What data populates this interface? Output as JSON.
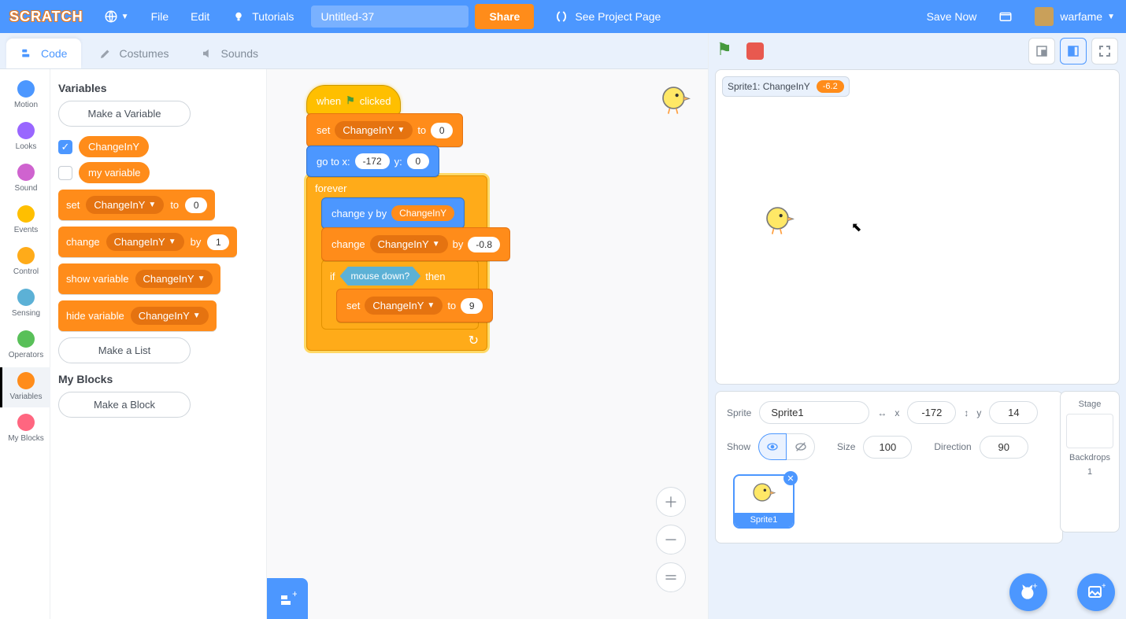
{
  "menubar": {
    "logo": "SCRATCH",
    "file": "File",
    "edit": "Edit",
    "tutorials": "Tutorials",
    "project_title": "Untitled-37",
    "share": "Share",
    "see_project_page": "See Project Page",
    "save_now": "Save Now",
    "username": "warfame"
  },
  "tabs": {
    "code": "Code",
    "costumes": "Costumes",
    "sounds": "Sounds"
  },
  "categories": [
    {
      "name": "Motion",
      "color": "#4C97FF"
    },
    {
      "name": "Looks",
      "color": "#9966FF"
    },
    {
      "name": "Sound",
      "color": "#CF63CF"
    },
    {
      "name": "Events",
      "color": "#FFBF00"
    },
    {
      "name": "Control",
      "color": "#FFAB19"
    },
    {
      "name": "Sensing",
      "color": "#5CB1D6"
    },
    {
      "name": "Operators",
      "color": "#59C059"
    },
    {
      "name": "Variables",
      "color": "#FF8C1A"
    },
    {
      "name": "My Blocks",
      "color": "#FF6680"
    }
  ],
  "palette": {
    "variables_header": "Variables",
    "make_variable": "Make a Variable",
    "var1": "ChangeInY",
    "var2": "my variable",
    "set_label": "set",
    "to_label": "to",
    "set_value": "0",
    "change_label": "change",
    "by_label": "by",
    "change_value": "1",
    "show_label": "show variable",
    "hide_label": "hide variable",
    "make_list": "Make a List",
    "myblocks_header": "My Blocks",
    "make_block": "Make a Block"
  },
  "script": {
    "hat_when": "when",
    "hat_clicked": "clicked",
    "set": "set",
    "to": "to",
    "set_val": "0",
    "gotox": "go to x:",
    "gox_v": "-172",
    "goy": "y:",
    "goy_v": "0",
    "forever": "forever",
    "changey": "change y by",
    "changey_var": "ChangeInY",
    "change": "change",
    "by": "by",
    "change_v": "-0.8",
    "if": "if",
    "then": "then",
    "mouse": "mouse down?",
    "set2_v": "9",
    "var": "ChangeInY"
  },
  "stage": {
    "monitor_label": "Sprite1: ChangeInY",
    "monitor_value": "-6.2"
  },
  "sprite_info": {
    "sprite_label": "Sprite",
    "sprite_name": "Sprite1",
    "x_label": "x",
    "x_value": "-172",
    "y_label": "y",
    "y_value": "14",
    "show_label": "Show",
    "size_label": "Size",
    "size_value": "100",
    "direction_label": "Direction",
    "direction_value": "90"
  },
  "stage_panel": {
    "title": "Stage",
    "backdrops_label": "Backdrops",
    "backdrops_count": "1"
  },
  "sprites": {
    "card1": "Sprite1"
  }
}
